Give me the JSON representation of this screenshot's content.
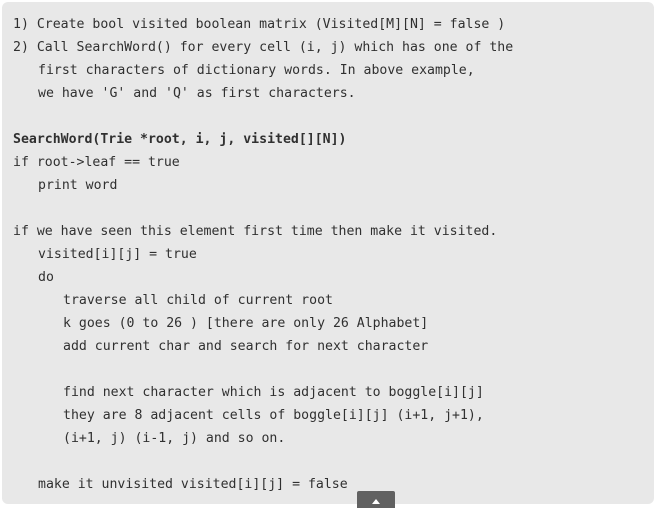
{
  "code": {
    "lines": [
      "1) Create bool visited boolean matrix (Visited[M][N] = false )",
      "2) Call SearchWord() for every cell (i, j) which has one of the",
      "first characters of dictionary words. In above example,",
      "we have 'G' and 'Q' as first characters.",
      "",
      "SearchWord(Trie *root, i, j, visited[][N])",
      "if root->leaf == true",
      "print word",
      "",
      "if we have seen this element first time then make it visited.",
      "visited[i][j] = true",
      "do",
      "traverse all child of current root",
      "k goes (0 to 26 ) [there are only 26 Alphabet]",
      "add current char and search for next character",
      "",
      "find next character which is adjacent to boggle[i][j]",
      "they are 8 adjacent cells of boggle[i][j] (i+1, j+1),",
      "(i+1, j) (i-1, j) and so on.",
      "",
      "make it unvisited visited[i][j] = false"
    ]
  },
  "scroll_button": {
    "icon": "chevron-up-icon"
  },
  "colors": {
    "panel_background": "#e8e8e8",
    "code_text": "#303030",
    "scroll_button": "#616161"
  }
}
